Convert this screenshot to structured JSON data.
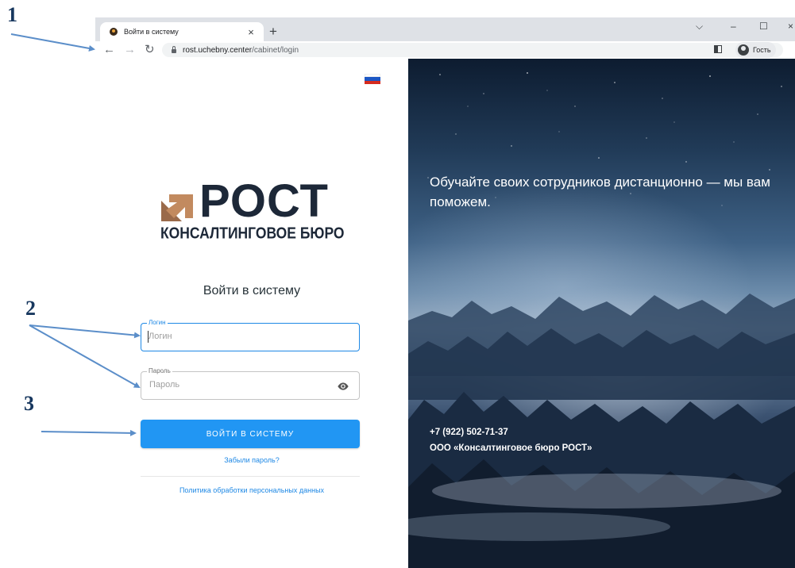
{
  "annotations": {
    "n1": "1",
    "n2": "2",
    "n3": "3"
  },
  "browser": {
    "tab_title": "Войти в систему",
    "tab_close": "×",
    "new_tab": "+",
    "win_menu": "⌵",
    "win_min": "–",
    "win_max": "☐",
    "win_close": "×",
    "url_host": "rost.uchebny.center",
    "url_path": "/cabinet/login",
    "profile_label": "Гость"
  },
  "login": {
    "logo_word": "РОСТ",
    "logo_sub": "КОНСАЛТИНГОВОЕ БЮРО",
    "heading": "Войти в систему",
    "login_label": "Логин",
    "login_placeholder": "Логин",
    "password_label": "Пароль",
    "password_placeholder": "Пароль",
    "submit": "ВОЙТИ В СИСТЕМУ",
    "forgot": "Забыли пароль?",
    "policy": "Политика обработки персональных данных"
  },
  "hero": {
    "title": "Обучайте своих сотрудников дистанционно — мы вам поможем.",
    "phone": "+7 (922) 502-71-37",
    "company": "ООО «Консалтинговое бюро РОСТ»"
  },
  "colors": {
    "accent": "#2196f3",
    "link": "#1e88e5",
    "logo_dark": "#1d2838",
    "logo_arrow": "#c28a5f",
    "annotation": "#5b8ec9"
  }
}
